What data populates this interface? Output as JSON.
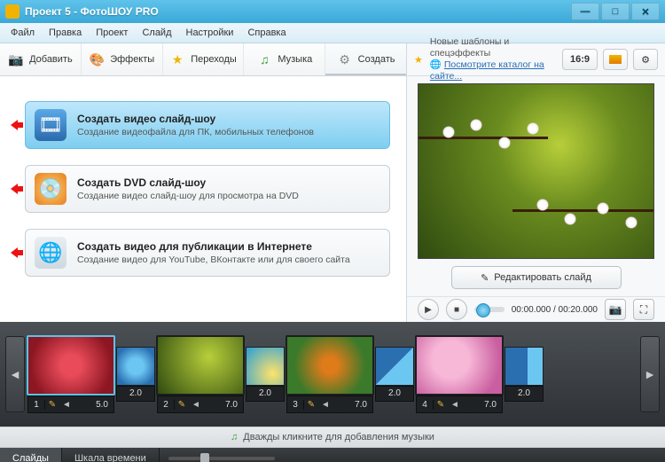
{
  "title": "Проект 5 - ФотоШОУ PRO",
  "menu": {
    "file": "Файл",
    "edit": "Правка",
    "project": "Проект",
    "slide": "Слайд",
    "settings": "Настройки",
    "help": "Справка"
  },
  "tabs": {
    "add": "Добавить",
    "effects": "Эффекты",
    "transitions": "Переходы",
    "music": "Музыка",
    "create": "Создать"
  },
  "create_options": [
    {
      "title": "Создать видео слайд-шоу",
      "desc": "Создание видеофайла для ПК, мобильных телефонов",
      "selected": true
    },
    {
      "title": "Создать DVD слайд-шоу",
      "desc": "Создание видео слайд-шоу для просмотра на DVD",
      "selected": false
    },
    {
      "title": "Создать видео для публикации в Интернете",
      "desc": "Создание видео для YouTube, ВКонтакте или для своего сайта",
      "selected": false
    }
  ],
  "news": {
    "line1": "Новые шаблоны и спецэффекты",
    "line2": "Посмотрите каталог на сайте..."
  },
  "aspect_label": "16:9",
  "edit_slide_btn": "Редактировать слайд",
  "player_time": "00:00.000 / 00:20.000",
  "timeline": {
    "slides": [
      {
        "num": "1",
        "duration": "5.0",
        "sel": true
      },
      {
        "num": "2",
        "duration": "7.0",
        "sel": false
      },
      {
        "num": "3",
        "duration": "7.0",
        "sel": false
      },
      {
        "num": "4",
        "duration": "7.0",
        "sel": false
      }
    ],
    "transitions": [
      {
        "d": "2.0"
      },
      {
        "d": "2.0"
      },
      {
        "d": "2.0"
      },
      {
        "d": "2.0"
      }
    ]
  },
  "music_hint": "Дважды кликните для добавления музыки",
  "bottom_tabs": {
    "slides": "Слайды",
    "timeline": "Шкала времени"
  }
}
